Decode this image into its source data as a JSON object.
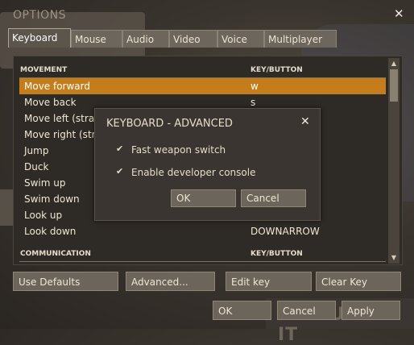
{
  "window": {
    "title": "OPTIONS",
    "close_label": "✕"
  },
  "tabs": [
    {
      "label": "Keyboard",
      "active": true
    },
    {
      "label": "Mouse",
      "active": false
    },
    {
      "label": "Audio",
      "active": false
    },
    {
      "label": "Video",
      "active": false
    },
    {
      "label": "Voice",
      "active": false
    },
    {
      "label": "Multiplayer",
      "active": false
    }
  ],
  "keyboard_list": {
    "headers": {
      "action": "MOVEMENT",
      "key": "KEY/BUTTON"
    },
    "rows": [
      {
        "action": "Move forward",
        "key": "w",
        "selected": true
      },
      {
        "action": "Move back",
        "key": "s"
      },
      {
        "action": "Move left (straf",
        "key": ""
      },
      {
        "action": "Move right (stra",
        "key": ""
      },
      {
        "action": "Jump",
        "key": ""
      },
      {
        "action": "Duck",
        "key": ""
      },
      {
        "action": "Swim up",
        "key": ""
      },
      {
        "action": "Swim down",
        "key": ""
      },
      {
        "action": "Look up",
        "key": ""
      },
      {
        "action": "Look down",
        "key": "DOWNARROW"
      }
    ],
    "section2_headers": {
      "action": "COMMUNICATION",
      "key": "KEY/BUTTON"
    }
  },
  "scrollbar": {
    "up_icon": "▲",
    "down_icon": "▼"
  },
  "buttons": {
    "use_defaults": "Use Defaults",
    "advanced": "Advanced...",
    "edit_key": "Edit key",
    "clear_key": "Clear Key",
    "ok": "OK",
    "cancel": "Cancel",
    "apply": "Apply"
  },
  "advanced_dialog": {
    "title": "KEYBOARD - ADVANCED",
    "close_label": "✕",
    "options": [
      {
        "label": "Fast weapon switch",
        "checked": true,
        "check": "✔"
      },
      {
        "label": "Enable developer console",
        "checked": true,
        "check": "✔"
      }
    ],
    "ok": "OK",
    "cancel": "Cancel"
  },
  "background": {
    "banner_text": "FEATURED IT"
  },
  "colors": {
    "accent": "#c57d1c",
    "panel": "#2e2a26",
    "button": "#6c655b"
  }
}
